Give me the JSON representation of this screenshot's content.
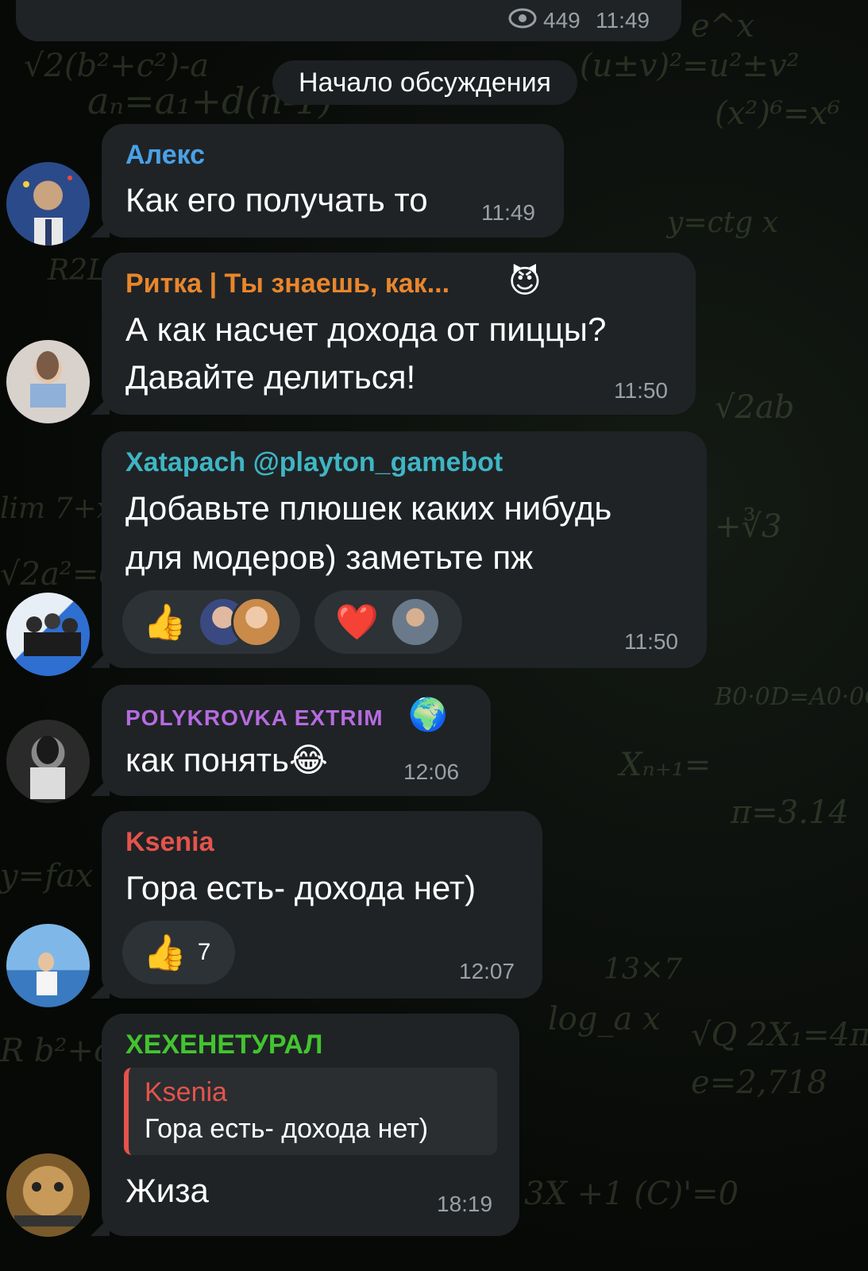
{
  "top_post": {
    "views": "449",
    "time": "11:49"
  },
  "divider": {
    "label": "Начало обсуждения"
  },
  "messages": [
    {
      "sender": "Алекс",
      "sender_color": "#4aa1e6",
      "text": "Как его получать то",
      "time": "11:49"
    },
    {
      "sender": "Ритка | Ты знаешь, как...",
      "sender_color": "#e8862c",
      "badge": "😈",
      "lines": [
        "А как насчет дохода от пиццы?",
        "Давайте делиться!"
      ],
      "time": "11:50"
    },
    {
      "sender": "Xatapach @playton_gamebot",
      "sender_color": "#3fb5c4",
      "lines": [
        "Добавьте плюшек каких нибудь",
        "для модеров) заметьте пж"
      ],
      "reactions": [
        {
          "emoji": "👍"
        },
        {
          "emoji": "❤️"
        }
      ],
      "time": "11:50"
    },
    {
      "sender": "POLYKROVKA EXTRIM",
      "sender_color": "#b66be0",
      "badge": "🌍",
      "text": "как понять😂",
      "time": "12:06"
    },
    {
      "sender": "Ksenia",
      "sender_color": "#e5534b",
      "text": "Гора есть- дохода нет)",
      "reactions": [
        {
          "emoji": "👍",
          "count": "7"
        }
      ],
      "time": "12:07"
    },
    {
      "sender": "ХЕХЕНЕТУРАЛ",
      "sender_color": "#43c42f",
      "reply": {
        "sender": "Ksenia",
        "text": "Гора есть- дохода нет)"
      },
      "text": "Жиза",
      "time": "18:19"
    }
  ],
  "colors": {
    "bubble": "#1f2326",
    "background": "#0b0f0c",
    "reply_accent": "#e5534b"
  }
}
